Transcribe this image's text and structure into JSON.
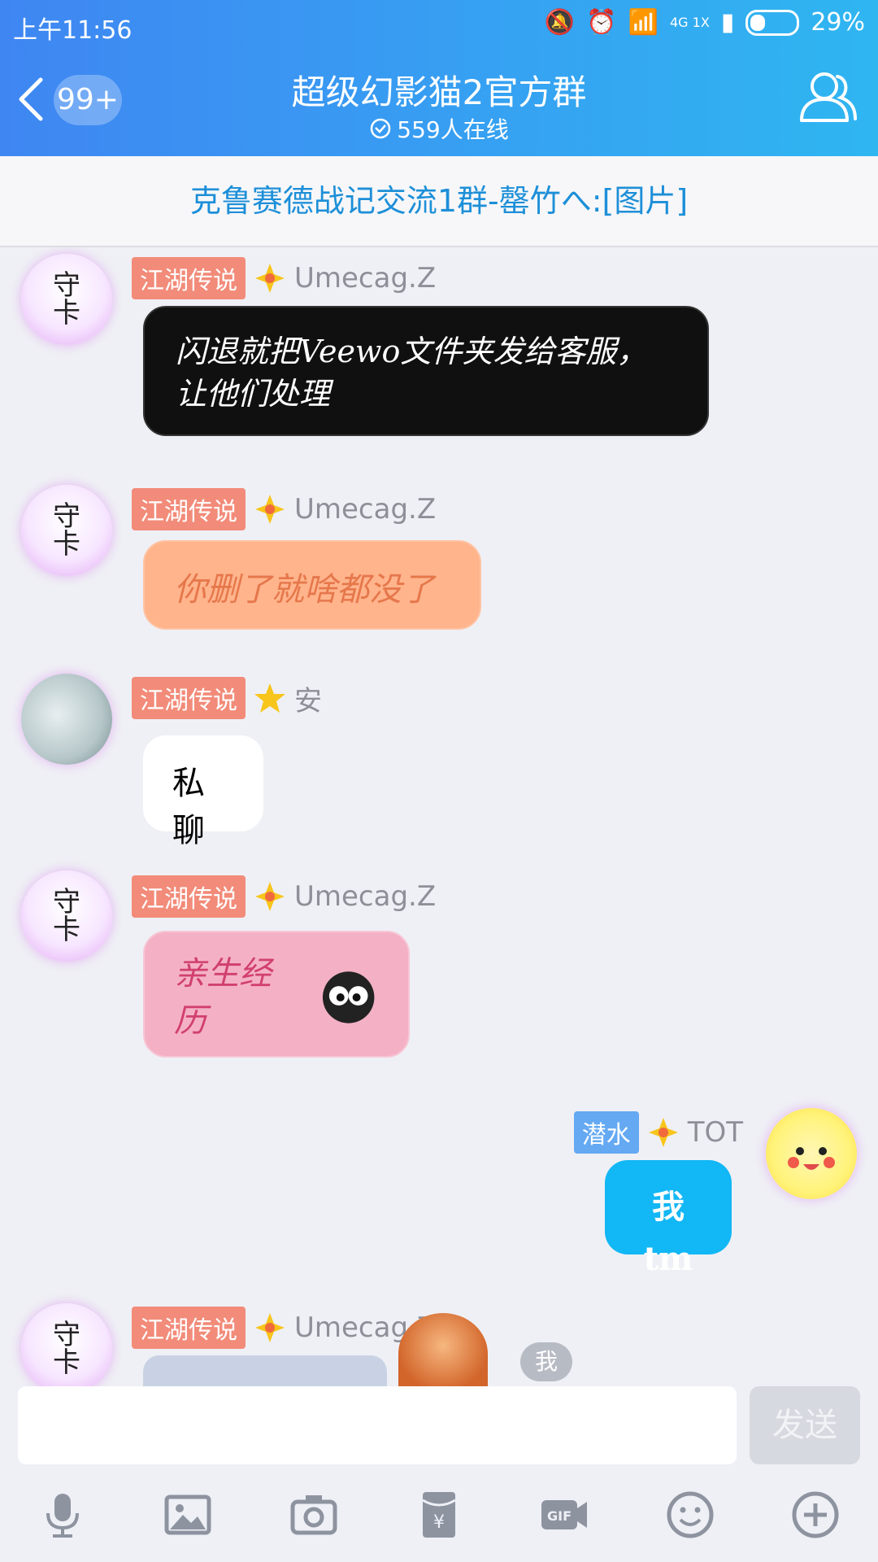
{
  "status_bar": {
    "time": "上午11:56",
    "battery": "29%",
    "network": "4G 1X"
  },
  "header": {
    "back_badge": "99+",
    "title": "超级幻影猫2官方群",
    "online": "559人在线"
  },
  "notice": {
    "text": "克鲁赛德战记交流1群-罄竹へ:[图片]"
  },
  "messages": [
    {
      "tag": "江湖传说",
      "name": "Umecag.Z",
      "text": "闪退就把Veewo文件夹发给客服，让他们处理"
    },
    {
      "tag": "江湖传说",
      "name": "Umecag.Z",
      "text": "你删了就啥都没了"
    },
    {
      "tag": "江湖传说",
      "name": "安",
      "text": "私聊"
    },
    {
      "tag": "江湖传说",
      "name": "Umecag.Z",
      "text": "亲生经历"
    },
    {
      "tag": "潜水",
      "name": "TOT",
      "text": "我tm"
    },
    {
      "tag": "江湖传说",
      "name": "Umecag.Z",
      "text": "我"
    }
  ],
  "avatar_text": {
    "line1": "守",
    "line2": "卡"
  },
  "input": {
    "placeholder": "",
    "send_label": "发送"
  },
  "toolbar": {
    "icons": [
      "mic-icon",
      "image-icon",
      "camera-icon",
      "red-packet-icon",
      "gif-icon",
      "emoji-icon",
      "plus-icon"
    ]
  }
}
